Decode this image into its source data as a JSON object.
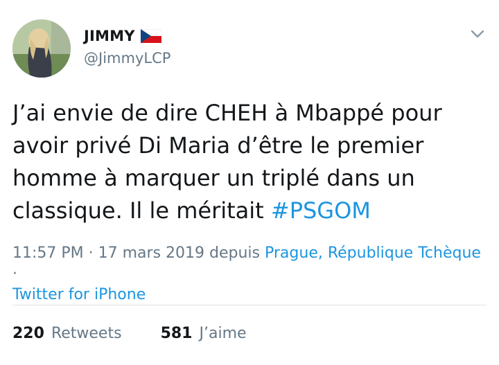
{
  "user": {
    "display_name": "JIMMY",
    "handle": "@JimmyLCP",
    "flag_icon": "czech-flag-icon"
  },
  "tweet": {
    "text": "J’ai envie de dire CHEH à Mbappé pour avoir privé Di Maria d’être le premier homme à marquer un triplé dans un classique. Il le méritait ",
    "hashtag": "#PSGOM"
  },
  "meta": {
    "time": "11:57 PM",
    "separator": " · ",
    "date": "17 mars 2019",
    "from_label": " depuis ",
    "location": "Prague, République Tchèque",
    "separator2": " ·",
    "source": "Twitter for iPhone"
  },
  "stats": {
    "retweets_count": "220",
    "retweets_label": "Retweets",
    "likes_count": "581",
    "likes_label": "J’aime"
  },
  "colors": {
    "accent": "#1b95e0",
    "secondary_text": "#657786",
    "primary_text": "#14171a",
    "divider": "#dfe3e6"
  }
}
